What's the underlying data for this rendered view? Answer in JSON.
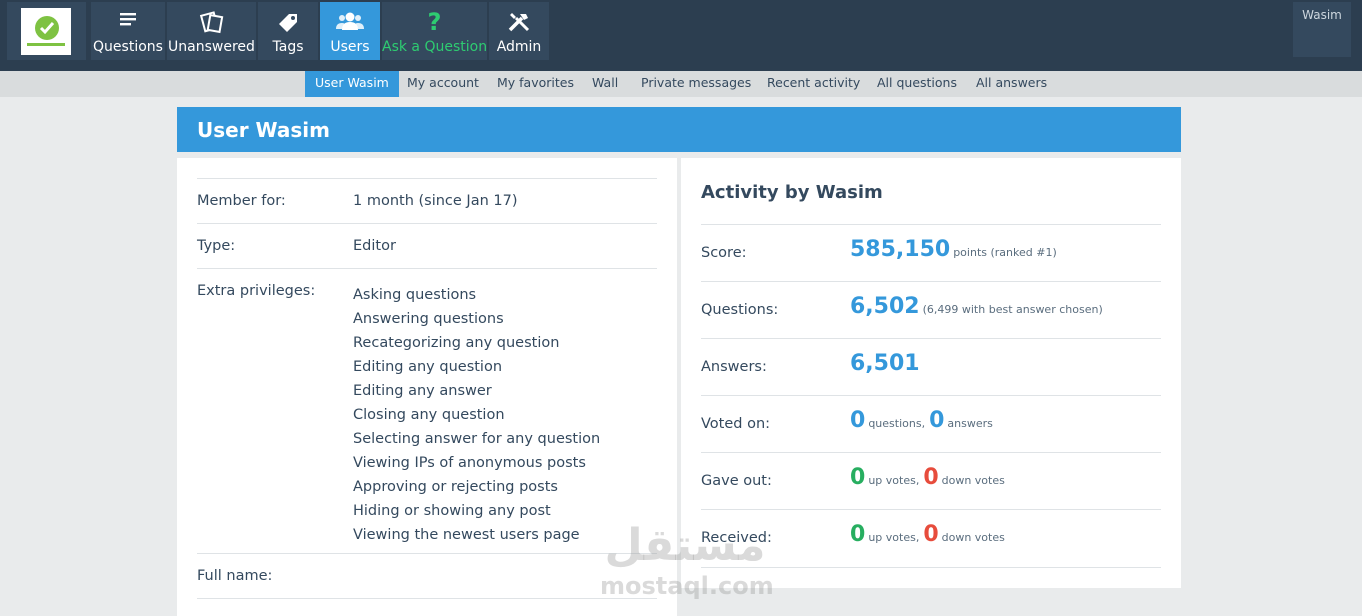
{
  "topnav": {
    "items": [
      {
        "label": "Questions",
        "icon": "list-icon"
      },
      {
        "label": "Unanswered",
        "icon": "unanswered-icon"
      },
      {
        "label": "Tags",
        "icon": "tag-icon"
      },
      {
        "label": "Users",
        "icon": "users-icon",
        "active": true
      },
      {
        "label": "Ask a Question",
        "icon": "question-mark-icon"
      },
      {
        "label": "Admin",
        "icon": "tools-icon"
      }
    ],
    "user": "Wasim",
    "colors": {
      "bar": "#2c3e50",
      "item": "#34495e",
      "active": "#3498db",
      "ask": "#2ecc71"
    }
  },
  "subnav": {
    "items": [
      {
        "label": "User Wasim",
        "active": true
      },
      {
        "label": "My account"
      },
      {
        "label": "My favorites"
      },
      {
        "label": "Wall"
      },
      {
        "label": "Private messages"
      },
      {
        "label": "Recent activity"
      },
      {
        "label": "All questions"
      },
      {
        "label": "All answers"
      }
    ]
  },
  "page": {
    "title": "User Wasim"
  },
  "profile": {
    "member_for_label": "Member for:",
    "member_for_value": "1 month (since Jan 17)",
    "type_label": "Type:",
    "type_value": "Editor",
    "privileges_label": "Extra privileges:",
    "privileges": [
      "Asking questions",
      "Answering questions",
      "Recategorizing any question",
      "Editing any question",
      "Editing any answer",
      "Closing any question",
      "Selecting answer for any question",
      "Viewing IPs of anonymous posts",
      "Approving or rejecting posts",
      "Hiding or showing any post",
      "Viewing the newest users page"
    ],
    "full_name_label": "Full name:"
  },
  "activity": {
    "title": "Activity by Wasim",
    "score_label": "Score:",
    "score_value": "585,150",
    "score_note": "points (ranked #1)",
    "questions_label": "Questions:",
    "questions_value": "6,502",
    "questions_note": "(6,499 with best answer chosen)",
    "answers_label": "Answers:",
    "answers_value": "6,501",
    "voted_label": "Voted on:",
    "voted_questions": "0",
    "voted_questions_unit": "questions,",
    "voted_answers": "0",
    "voted_answers_unit": "answers",
    "gave_label": "Gave out:",
    "gave_up": "0",
    "gave_up_unit": "up votes,",
    "gave_down": "0",
    "gave_down_unit": "down votes",
    "received_label": "Received:",
    "received_up": "0",
    "received_up_unit": "up votes,",
    "received_down": "0",
    "received_down_unit": "down votes"
  },
  "watermark": {
    "arabic": "مستقل",
    "latin": "mostaql.com"
  }
}
